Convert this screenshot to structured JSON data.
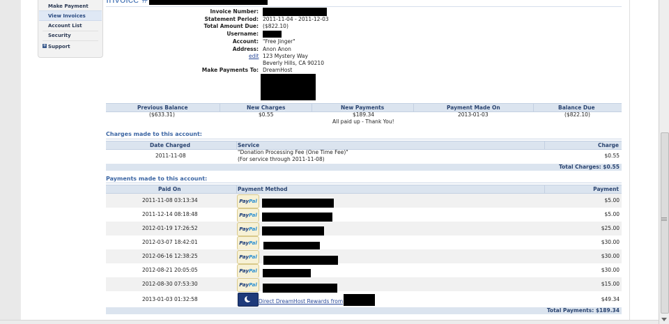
{
  "sidebar": {
    "items": [
      {
        "label": "Make Payment"
      },
      {
        "label": "View Invoices"
      },
      {
        "label": "Account List"
      },
      {
        "label": "Security"
      },
      {
        "label": "Support"
      }
    ]
  },
  "invoice": {
    "title": "Invoice #",
    "fields": [
      {
        "label": "Invoice Number:",
        "value": ""
      },
      {
        "label": "Statement Period:",
        "value": "2011-11-04 - 2011-12-03"
      },
      {
        "label": "Total Amount Due:",
        "value": "($822.10)"
      },
      {
        "label": "Username:",
        "value": ""
      },
      {
        "label": "Account:",
        "value": "\"Free Jinger\""
      },
      {
        "label": "Address:",
        "value": "Anon Anon"
      }
    ],
    "address_lines": [
      "123 Mystery Way",
      "Beverly Hills, CA 90210"
    ],
    "edit_label": "edit",
    "pay_to_label": "Make Payments To:",
    "pay_to_value": "DreamHost"
  },
  "summary": {
    "headers": [
      "Previous Balance",
      "New Charges",
      "New Payments",
      "Payment Made On",
      "Balance Due"
    ],
    "values": [
      "($633.31)",
      "$0.55",
      "$189.34",
      "2013-01-03",
      "($822.10)"
    ],
    "note": "All paid up - Thank You!"
  },
  "charges": {
    "title": "Charges made to this account:",
    "headers": [
      "Date Charged",
      "Service",
      "Charge"
    ],
    "rows": [
      {
        "date": "2011-11-08",
        "service": "\"Donation Processing Fee (One Time Fee)\"",
        "service2": "(For service through 2011-11-08)",
        "charge": "$0.55"
      }
    ],
    "total": "Total Charges: $0.55"
  },
  "payments": {
    "title": "Payments made to this account:",
    "headers": [
      "Paid On",
      "Payment Method",
      "Payment"
    ],
    "paypal_a": "Pay",
    "paypal_b": "Pal",
    "rows": [
      {
        "date": "2011-11-08 03:13:34",
        "amount": "$5.00"
      },
      {
        "date": "2011-12-14 08:18:48",
        "amount": "$5.00"
      },
      {
        "date": "2012-01-19 17:26:52",
        "amount": "$25.00"
      },
      {
        "date": "2012-03-07 18:42:01",
        "amount": "$30.00"
      },
      {
        "date": "2012-06-16 12:38:25",
        "amount": "$30.00"
      },
      {
        "date": "2012-08-21 20:05:05",
        "amount": "$30.00"
      },
      {
        "date": "2012-08-30 07:53:30",
        "amount": "$15.00"
      },
      {
        "date": "2013-01-03 01:32:58",
        "amount": "$49.34",
        "method_text": "Direct DreamHost Rewards from"
      }
    ],
    "total": "Total Payments: $189.34"
  }
}
